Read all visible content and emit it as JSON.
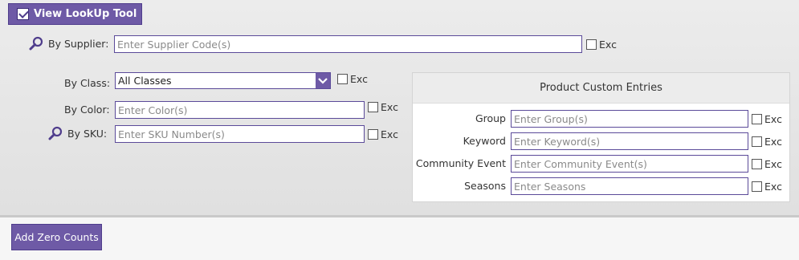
{
  "toolbar": {
    "lookup_label": "View LookUp Tool",
    "zero_counts_label": "Add Zero Counts"
  },
  "fields": {
    "supplier": {
      "label": "By Supplier:",
      "placeholder": "Enter Supplier Code(s)",
      "exc": "Exc"
    },
    "class": {
      "label": "By Class:",
      "selected": "All Classes",
      "exc": "Exc"
    },
    "color": {
      "label": "By Color:",
      "placeholder": "Enter Color(s)",
      "exc": "Exc"
    },
    "sku": {
      "label": "By SKU:",
      "placeholder": "Enter SKU Number(s)",
      "exc": "Exc"
    }
  },
  "custom": {
    "title": "Product Custom Entries",
    "rows": [
      {
        "label": "Group",
        "placeholder": "Enter Group(s)",
        "exc": "Exc"
      },
      {
        "label": "Keyword",
        "placeholder": "Enter Keyword(s)",
        "exc": "Exc"
      },
      {
        "label": "Community Event",
        "placeholder": "Enter Community Event(s)",
        "exc": "Exc"
      },
      {
        "label": "Seasons",
        "placeholder": "Enter Seasons",
        "exc": "Exc"
      }
    ]
  },
  "colors": {
    "accent": "#6e5aa6",
    "accent_border": "#4f3d8c",
    "input_border": "#5b4a99"
  },
  "icons": {
    "lookup": "magnifier-icon",
    "dropdown": "chevron-down-icon"
  }
}
